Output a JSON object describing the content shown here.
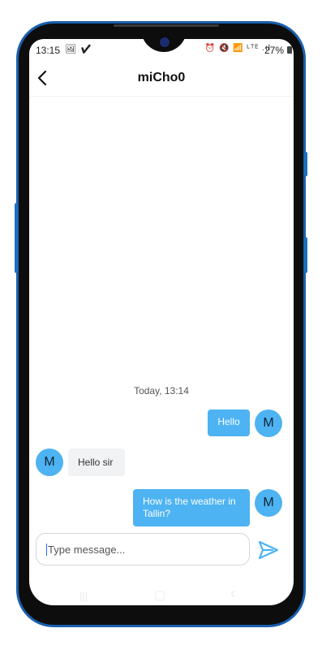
{
  "status_bar": {
    "time": "13:15",
    "left_icons": "🖼 ✔",
    "right_icons": "⏰ 🔇 📶 ᴸᵀᴱ .ıl",
    "battery": "27%"
  },
  "header": {
    "title": "miCho0"
  },
  "chat": {
    "timestamp": "Today, 13:14",
    "messages": [
      {
        "direction": "outgoing",
        "text": "Hello",
        "avatar": "M"
      },
      {
        "direction": "incoming",
        "text": "Hello sir",
        "avatar": "M"
      },
      {
        "direction": "outgoing",
        "text": "How is the weather in Tallin?",
        "avatar": "M"
      }
    ]
  },
  "composer": {
    "placeholder": "Type message...",
    "value": ""
  },
  "nav": {
    "recents": "|||",
    "home": "▢",
    "back": "‹"
  },
  "colors": {
    "accent": "#4db3f2",
    "frame": "#1a5fae"
  },
  "icons": {
    "back": "chevron-left-icon",
    "send": "send-icon"
  }
}
